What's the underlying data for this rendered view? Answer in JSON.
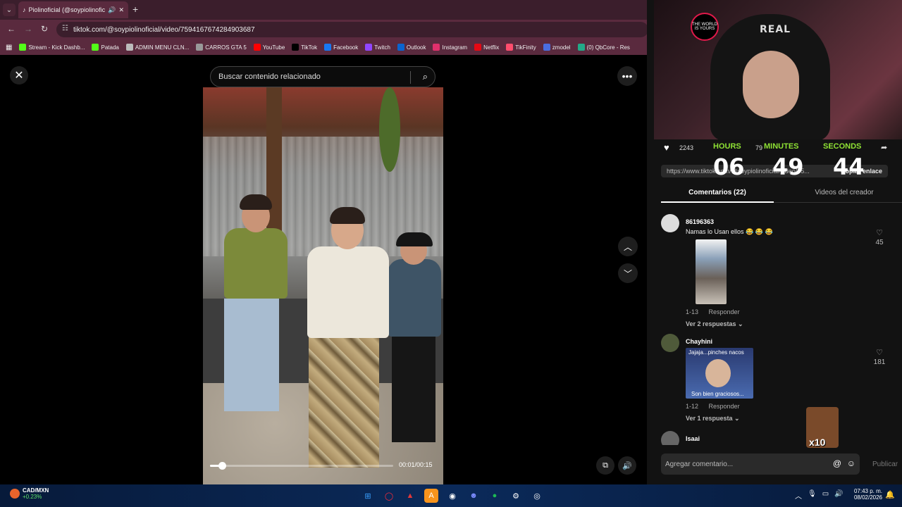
{
  "browser": {
    "tab_title": "Piolinoficial (@soypiolinofic",
    "url": "tiktok.com/@soypiolinoficial/video/7594167674284903687",
    "bookmarks": [
      {
        "label": "Stream - Kick Dashb...",
        "color": "#53fc18"
      },
      {
        "label": "Patada",
        "color": "#53fc18"
      },
      {
        "label": "ADMIN MENU CLN...",
        "color": "#bbbbbb"
      },
      {
        "label": "CARROS GTA 5",
        "color": "#999999"
      },
      {
        "label": "YouTube",
        "color": "#ff0000"
      },
      {
        "label": "TikTok",
        "color": "#000000"
      },
      {
        "label": "Facebook",
        "color": "#1877f2"
      },
      {
        "label": "Twitch",
        "color": "#9146ff"
      },
      {
        "label": "Outlook",
        "color": "#0a64d0"
      },
      {
        "label": "Instagram",
        "color": "#e1306c"
      },
      {
        "label": "Netflix",
        "color": "#e50914"
      },
      {
        "label": "TikFinity",
        "color": "#ff4d6d"
      },
      {
        "label": "zmodel",
        "color": "#4a6ee0"
      },
      {
        "label": "(0) QbCore - Res",
        "color": "#22aa88"
      }
    ]
  },
  "viewer": {
    "search_placeholder": "Buscar contenido relacionado",
    "time": "00:01/00:15",
    "progress_fraction": 0.0667
  },
  "panel": {
    "likes": "2243",
    "comments_count": "79",
    "link": "https://www.tiktok.com/@soypiolinoficial/video/75...",
    "copy_label": "Copiar enlace",
    "tabs": [
      "Comentarios (22)",
      "Videos del creador"
    ],
    "webcam_logo": "THE WORLD IS YOURS",
    "webcam_cap_text": "REAL"
  },
  "timer": {
    "hours_label": "HOURS",
    "minutes_label": "MINUTES",
    "seconds_label": "SECONDS",
    "hours": "06",
    "minutes": "49",
    "seconds": "44"
  },
  "comments": [
    {
      "user": "86196363",
      "text": "Namas lo Usan ellos 😂 😂 😂",
      "date": "1-13",
      "reply_label": "Responder",
      "replies": "Ver 2 respuestas ⌄",
      "likes": "45"
    },
    {
      "user": "Chayhini",
      "media_top": "Jajaja...pinches nacos",
      "media_bottom": "Son bien graciosos...",
      "date": "1-12",
      "reply_label": "Responder",
      "replies": "Ver 1 respuesta ⌄",
      "likes": "181"
    },
    {
      "user": "Isaai"
    }
  ],
  "reaction_badge": "x10",
  "composer": {
    "placeholder": "Agregar comentario...",
    "publish": "Publicar"
  },
  "taskbar": {
    "ticker_symbol": "CAD/MXN",
    "ticker_change": "+0.23%",
    "time": "07:43 p. m.",
    "date": "08/02/2026"
  }
}
